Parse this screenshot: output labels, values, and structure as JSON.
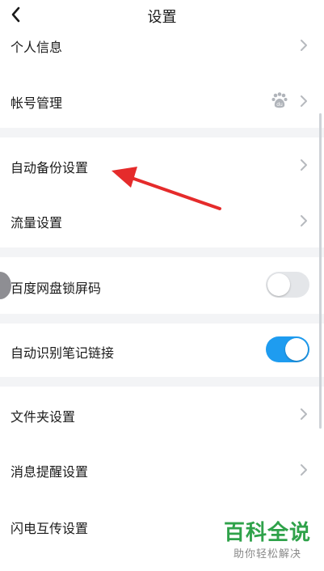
{
  "header": {
    "title": "设置"
  },
  "items": {
    "personal_info": "个人信息",
    "account": "帐号管理",
    "auto_backup": "自动备份设置",
    "traffic": "流量设置",
    "lock": "百度网盘锁屏码",
    "note_link": "自动识别笔记链接",
    "folder": "文件夹设置",
    "notify": "消息提醒设置",
    "flash_transfer": "闪电互传设置"
  },
  "toggles": {
    "lock_on": false,
    "note_link_on": true
  },
  "watermark": {
    "title": "百科全说",
    "subtitle": "助你轻松解决"
  },
  "colors": {
    "toggle_on": "#1e9cf0",
    "toggle_off": "#e4e6e9",
    "arrow": "#e52b2b",
    "section_gap": "#f3f4f6",
    "watermark_green": "#2fa24a"
  }
}
